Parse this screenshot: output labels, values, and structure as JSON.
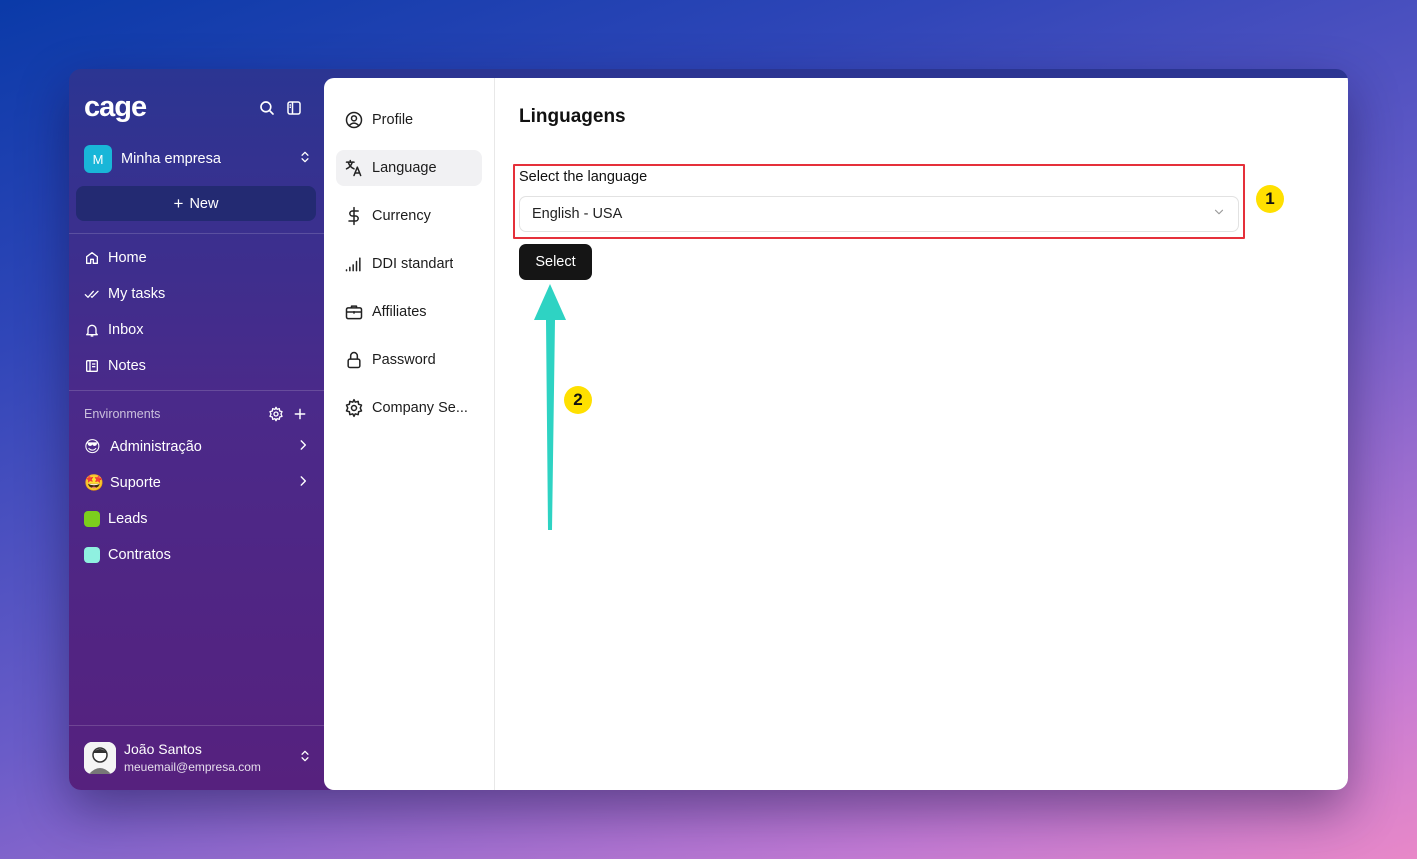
{
  "sidebar": {
    "logo": "cage",
    "company": {
      "initial": "M",
      "name": "Minha empresa"
    },
    "new_label": "New",
    "nav": [
      {
        "label": "Home",
        "icon": "home-icon"
      },
      {
        "label": "My tasks",
        "icon": "double-check-icon"
      },
      {
        "label": "Inbox",
        "icon": "bell-icon"
      },
      {
        "label": "Notes",
        "icon": "notes-icon"
      }
    ],
    "environments": {
      "label": "Environments",
      "items": [
        {
          "label": "Administração",
          "emoji": "😎",
          "has_children": true
        },
        {
          "label": "Suporte",
          "emoji": "🤩",
          "has_children": true
        },
        {
          "label": "Leads",
          "color": "#7ccf1d",
          "has_children": false
        },
        {
          "label": "Contratos",
          "color": "#8ff0e0",
          "has_children": false
        }
      ]
    },
    "user": {
      "name": "João Santos",
      "email": "meuemail@empresa.com"
    }
  },
  "settings_nav": [
    {
      "label": "Profile",
      "icon": "user-circle-icon",
      "active": false
    },
    {
      "label": "Language",
      "icon": "translate-icon",
      "active": true
    },
    {
      "label": "Currency",
      "icon": "dollar-icon",
      "active": false
    },
    {
      "label": "DDI standart",
      "icon": "signal-bars-icon",
      "active": false
    },
    {
      "label": "Affiliates",
      "icon": "briefcase-icon",
      "active": false
    },
    {
      "label": "Password",
      "icon": "lock-icon",
      "active": false
    },
    {
      "label": "Company Se...",
      "icon": "gear-icon",
      "active": false
    }
  ],
  "content": {
    "title": "Linguagens",
    "field_label": "Select the language",
    "selected_language": "English - USA",
    "button_label": "Select"
  },
  "annotations": {
    "badge_1": "1",
    "badge_2": "2",
    "highlight_color": "#e5303a",
    "arrow_color": "#2ed3c3",
    "badge_color": "#ffe000"
  },
  "colors": {
    "accent_company": "#19b6d8",
    "button_dark": "#151515"
  }
}
